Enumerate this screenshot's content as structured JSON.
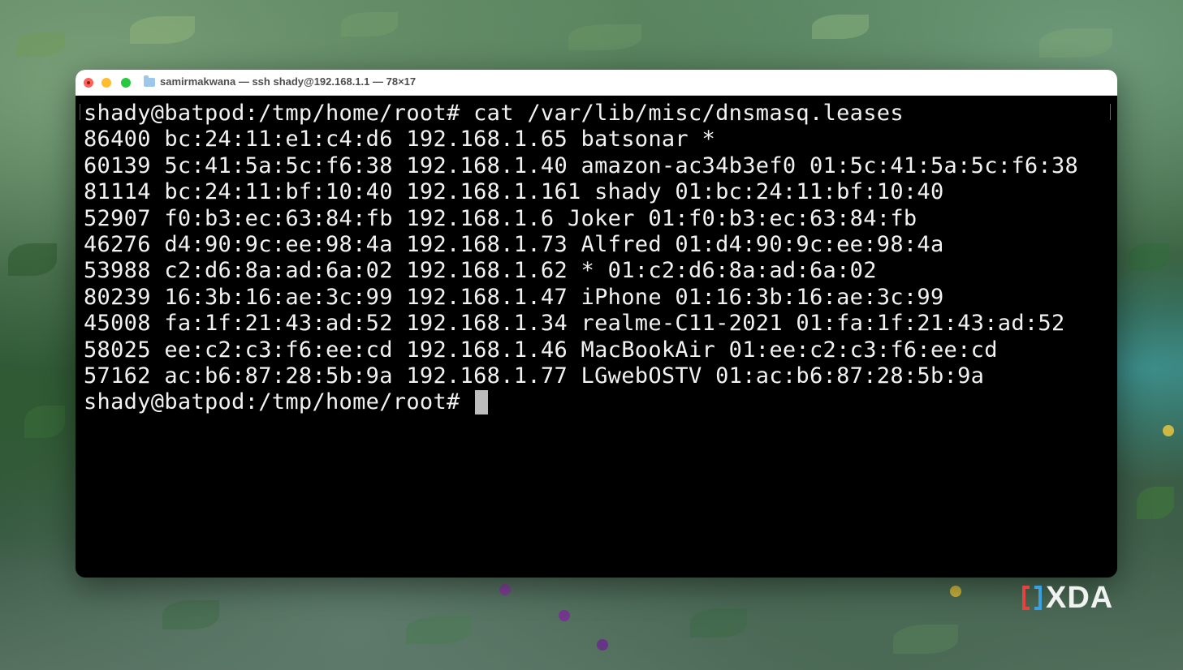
{
  "window": {
    "title": "samirmakwana — ssh shady@192.168.1.1 — 78×17",
    "traffic_light_colors": {
      "close": "#ff5f57",
      "minimize": "#febc2e",
      "zoom": "#28c840"
    }
  },
  "terminal": {
    "lines": [
      "shady@batpod:/tmp/home/root# cat /var/lib/misc/dnsmasq.leases",
      "86400 bc:24:11:e1:c4:d6 192.168.1.65 batsonar *",
      "60139 5c:41:5a:5c:f6:38 192.168.1.40 amazon-ac34b3ef0 01:5c:41:5a:5c:f6:38",
      "81114 bc:24:11:bf:10:40 192.168.1.161 shady 01:bc:24:11:bf:10:40",
      "52907 f0:b3:ec:63:84:fb 192.168.1.6 Joker 01:f0:b3:ec:63:84:fb",
      "46276 d4:90:9c:ee:98:4a 192.168.1.73 Alfred 01:d4:90:9c:ee:98:4a",
      "53988 c2:d6:8a:ad:6a:02 192.168.1.62 * 01:c2:d6:8a:ad:6a:02",
      "80239 16:3b:16:ae:3c:99 192.168.1.47 iPhone 01:16:3b:16:ae:3c:99",
      "45008 fa:1f:21:43:ad:52 192.168.1.34 realme-C11-2021 01:fa:1f:21:43:ad:52",
      "58025 ee:c2:c3:f6:ee:cd 192.168.1.46 MacBookAir 01:ee:c2:c3:f6:ee:cd",
      "57162 ac:b6:87:28:5b:9a 192.168.1.77 LGwebOSTV 01:ac:b6:87:28:5b:9a"
    ],
    "prompt": "shady@batpod:/tmp/home/root# ",
    "background_color": "#000000",
    "text_color": "#f2f2f2"
  },
  "watermark": {
    "text": "XDA",
    "bracket_colors": [
      "#e8423f",
      "#3aa0e0"
    ]
  }
}
